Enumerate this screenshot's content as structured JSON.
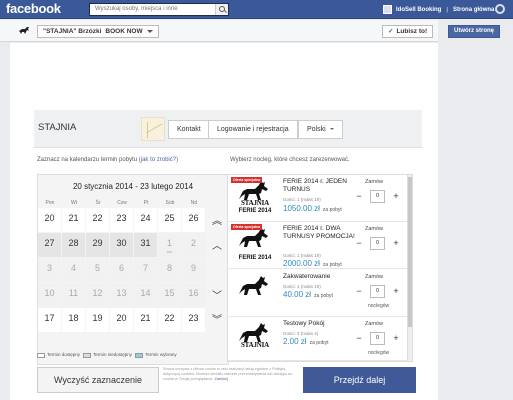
{
  "facebook": {
    "logo": "facebook",
    "search_placeholder": "Wyszukaj osoby, miejsca i inne",
    "user_name": "IdoSell Booking",
    "home_link": "Strona główna"
  },
  "page_bar": {
    "page_name": "\"STAJNIA\" Brzózki",
    "tab_name": "BOOK NOW",
    "like_label": "Lubisz to!",
    "create_page_label": "Utwórz stronę"
  },
  "shop": {
    "name": "STAJNIA",
    "nav": {
      "contact": "Kontakt",
      "login": "Logowanie i rejestracja",
      "language": "Polski"
    },
    "hint_left": "Zaznacz na kalendarzu termin pobytu",
    "hint_left_link": "(jak to zrobić?)",
    "hint_right": "Wybierz nocleg, które chcesz zarezerwować."
  },
  "calendar": {
    "range": "20 stycznia 2014 - 23 lutego 2014",
    "weekdays": [
      "Pon",
      "Wt",
      "Śr",
      "Czw",
      "Pt",
      "Sob",
      "Nd"
    ],
    "weeks": [
      [
        "20",
        "21",
        "22",
        "23",
        "24",
        "25",
        "26"
      ],
      [
        "27",
        "28",
        "29",
        "30",
        "31",
        "1",
        "2"
      ],
      [
        "3",
        "4",
        "5",
        "6",
        "7",
        "8",
        "9"
      ],
      [
        "10",
        "11",
        "12",
        "13",
        "14",
        "15",
        "16"
      ],
      [
        "17",
        "18",
        "19",
        "20",
        "21",
        "22",
        "23"
      ]
    ],
    "month_sub_label": "lut",
    "legend": {
      "available": "Termin dostępny",
      "unavailable": "Termin niedostępny",
      "selected": "Termin wybrany"
    }
  },
  "offers": {
    "order_label": "Zamów",
    "nights_label": "noclegów",
    "per_stay": "za pobyt",
    "special_badge": "Oferta specjalna",
    "brand": "STAJNIA",
    "brand_sub": "FERIE 2014",
    "items": [
      {
        "title": "FERIE 2014 r. JEDEN TURNUS",
        "guests": "Gości: 1 (maks 19)",
        "price": "1050.00 zł",
        "qty": "0"
      },
      {
        "title": "FERIE 2014 r. DWA TURNUSY PROMOCJA!",
        "guests": "Gości: 1 (maks 19)",
        "price": "2000.00 zł",
        "qty": "0"
      },
      {
        "title": "Zakwaterowanie",
        "guests": "Gości: 1 (maks 19)",
        "price": "40.00 zł",
        "qty": "0"
      },
      {
        "title": "Testowy Pokój",
        "guests": "Gości: 3 (maks 4)",
        "price": "2.00 zł",
        "qty": "0"
      }
    ]
  },
  "footer": {
    "clear_label": "Wyczyść zaznaczenie",
    "cookie_text": "Strona korzysta z plików cookie w celu realizacji usług zgodnie z Polityką dotyczącą cookies. Możesz określić warunki przechowywania lub dostępu do cookie w Twojej przeglądarce.",
    "cookie_close": "Zamknij",
    "next_label": "Przejdź dalej"
  },
  "colors": {
    "fb_blue": "#3b5998",
    "accent_blue": "#3f5a96",
    "price_blue": "#2e8bbd",
    "badge_red": "#d6312e"
  }
}
